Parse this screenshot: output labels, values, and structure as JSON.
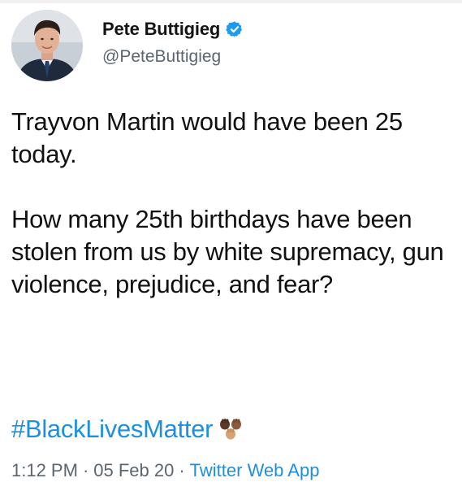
{
  "author": {
    "display_name": "Pete Buttigieg",
    "handle": "@PeteButtigieg",
    "verified": true,
    "verified_badge_color": "#1d9bf0"
  },
  "tweet": {
    "paragraphs": [
      "Trayvon Martin would have been 25 today.",
      "How many 25th birthdays have been stolen from us by white supremacy, gun violence, prejudice, and fear?"
    ],
    "hashtag": "#BlackLivesMatter",
    "emoji": "raised-fist-skin-tones-icon"
  },
  "meta": {
    "time": "1:12 PM",
    "separator": "·",
    "date": "05 Feb 20",
    "source": "Twitter Web App"
  },
  "colors": {
    "link_blue": "#1d8fe0",
    "secondary_text": "#5b6670",
    "primary_text": "#111111"
  }
}
